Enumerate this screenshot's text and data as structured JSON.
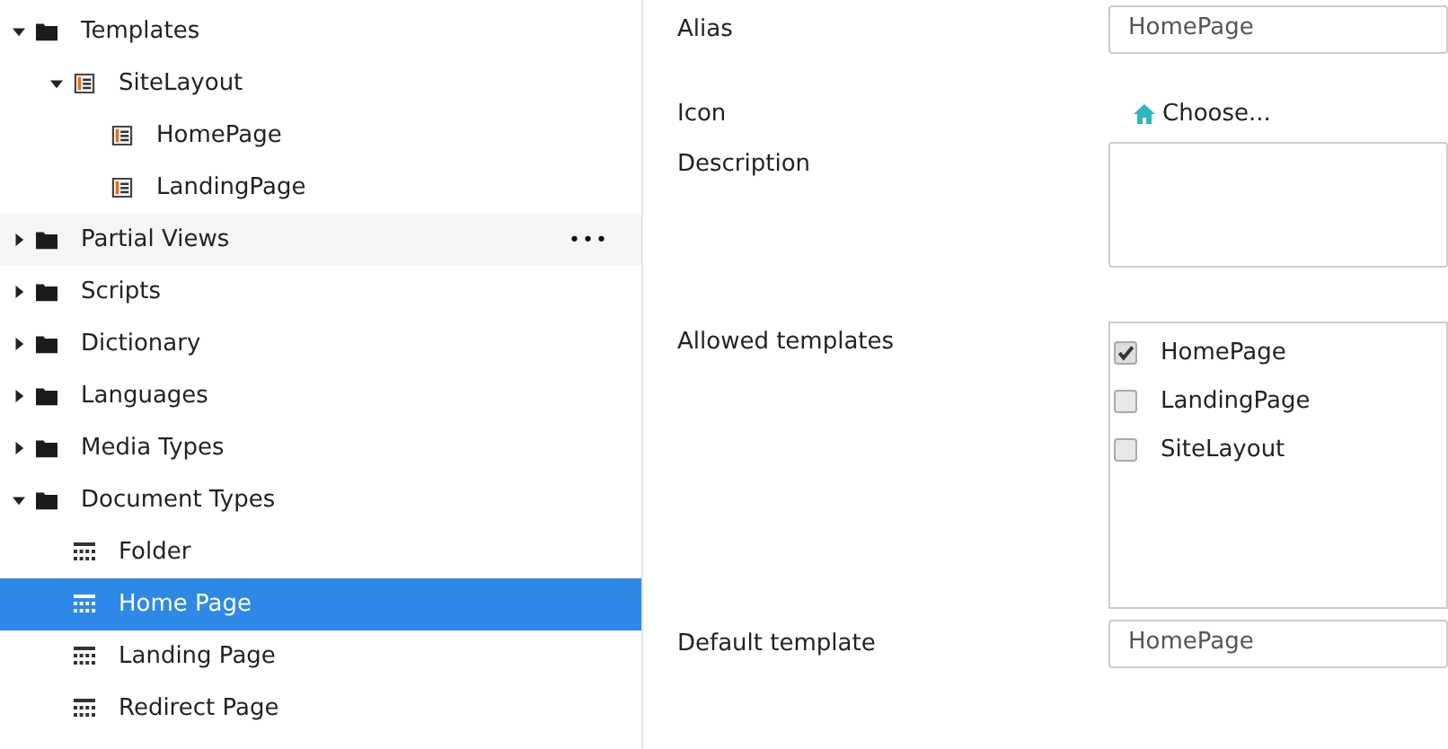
{
  "tree": [
    {
      "label": "Templates",
      "kind": "folder",
      "expanded": true,
      "selected": false,
      "children": [
        {
          "label": "SiteLayout",
          "kind": "template",
          "expanded": true,
          "selected": false,
          "children": [
            {
              "label": "HomePage",
              "kind": "template",
              "selected": false
            },
            {
              "label": "LandingPage",
              "kind": "template",
              "selected": false
            }
          ]
        }
      ]
    },
    {
      "label": "Partial Views",
      "kind": "folder",
      "expanded": false,
      "selected": false,
      "action": "•••"
    },
    {
      "label": "Scripts",
      "kind": "folder",
      "expanded": false,
      "selected": false
    },
    {
      "label": "Dictionary",
      "kind": "folder",
      "expanded": false,
      "selected": false
    },
    {
      "label": "Languages",
      "kind": "folder",
      "expanded": false,
      "selected": false
    },
    {
      "label": "Media Types",
      "kind": "folder",
      "expanded": false,
      "selected": false
    },
    {
      "label": "Document Types",
      "kind": "folder",
      "expanded": true,
      "selected": false,
      "children": [
        {
          "label": "Folder",
          "kind": "doctype",
          "selected": false
        },
        {
          "label": "Home Page",
          "kind": "doctype",
          "selected": true
        },
        {
          "label": "Landing Page",
          "kind": "doctype",
          "selected": false
        },
        {
          "label": "Redirect Page",
          "kind": "doctype",
          "selected": false
        }
      ]
    }
  ],
  "form": {
    "alias": {
      "label": "Alias",
      "value": "HomePage"
    },
    "icon": {
      "label": "Icon",
      "button": "Choose..."
    },
    "description": {
      "label": "Description"
    },
    "allowed_templates": {
      "label": "Allowed templates",
      "options": [
        {
          "label": "HomePage",
          "checked": true
        },
        {
          "label": "LandingPage",
          "checked": false
        },
        {
          "label": "SiteLayout",
          "checked": false
        }
      ]
    },
    "default_template": {
      "label": "Default template",
      "value": "HomePage"
    }
  }
}
